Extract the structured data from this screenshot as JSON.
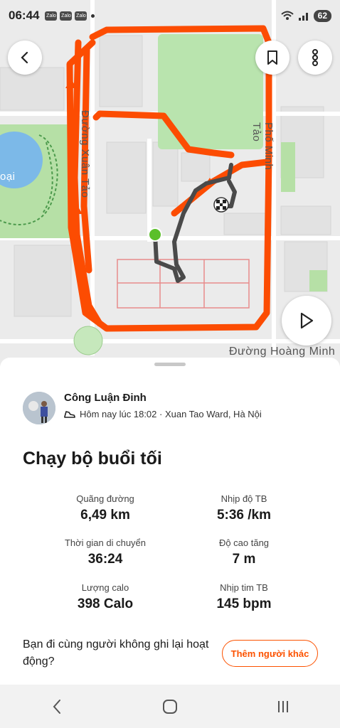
{
  "status_bar": {
    "time": "06:44",
    "app_icons": [
      "Zalo",
      "Zalo",
      "Zalo"
    ],
    "battery": "62"
  },
  "map": {
    "street_labels": [
      "Đường Xuân Tảo",
      "Phố Minh Tảo",
      "Đường Hoàng Minh",
      "oại"
    ],
    "route_color": "#fc4c02",
    "track_color": "#4a4a4a",
    "start_color": "#5bbf2a"
  },
  "activity": {
    "athlete_name": "Công Luận Đinh",
    "datetime_location": "Hôm nay lúc 18:02 · Xuan Tao Ward, Hà Nội",
    "title": "Chạy bộ buổi tối",
    "stats": [
      {
        "label": "Quãng đường",
        "value": "6,49 km"
      },
      {
        "label": "Nhịp độ TB",
        "value": "5:36 /km"
      },
      {
        "label": "Thời gian di chuyển",
        "value": "36:24"
      },
      {
        "label": "Độ cao tăng",
        "value": "7 m"
      },
      {
        "label": "Lượng calo",
        "value": "398 Calo"
      },
      {
        "label": "Nhịp tim TB",
        "value": "145 bpm"
      }
    ],
    "prompt": "Bạn đi cùng người không ghi lại hoạt động?",
    "add_button": "Thêm người khác"
  },
  "colors": {
    "accent": "#fc5200"
  }
}
